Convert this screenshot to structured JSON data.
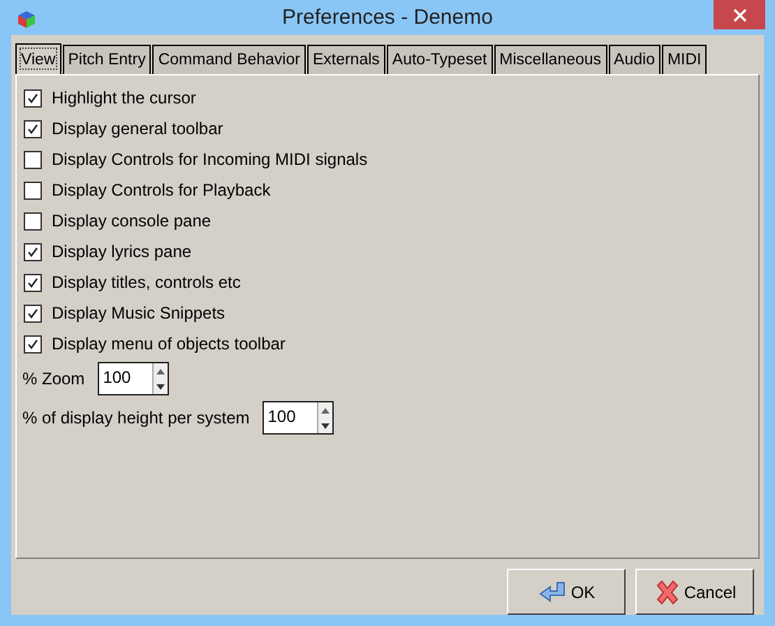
{
  "window": {
    "title": "Preferences - Denemo"
  },
  "tabs": [
    {
      "label": "View",
      "selected": true
    },
    {
      "label": "Pitch Entry",
      "selected": false
    },
    {
      "label": "Command Behavior",
      "selected": false
    },
    {
      "label": "Externals",
      "selected": false
    },
    {
      "label": "Auto-Typeset",
      "selected": false
    },
    {
      "label": "Miscellaneous",
      "selected": false
    },
    {
      "label": "Audio",
      "selected": false
    },
    {
      "label": "MIDI",
      "selected": false
    }
  ],
  "options": [
    {
      "label": "Highlight the cursor",
      "checked": true
    },
    {
      "label": "Display general toolbar",
      "checked": true
    },
    {
      "label": "Display Controls for Incoming MIDI signals",
      "checked": false
    },
    {
      "label": "Display Controls for Playback",
      "checked": false
    },
    {
      "label": "Display console pane",
      "checked": false
    },
    {
      "label": "Display lyrics pane",
      "checked": true
    },
    {
      "label": "Display titles, controls etc",
      "checked": true
    },
    {
      "label": "Display Music Snippets",
      "checked": true
    },
    {
      "label": "Display menu of objects toolbar",
      "checked": true
    }
  ],
  "spinners": [
    {
      "label": "% Zoom",
      "value": "100"
    },
    {
      "label": "% of display height per system",
      "value": "100"
    }
  ],
  "buttons": [
    {
      "label": "OK",
      "kind": "ok"
    },
    {
      "label": "Cancel",
      "kind": "cancel"
    }
  ]
}
